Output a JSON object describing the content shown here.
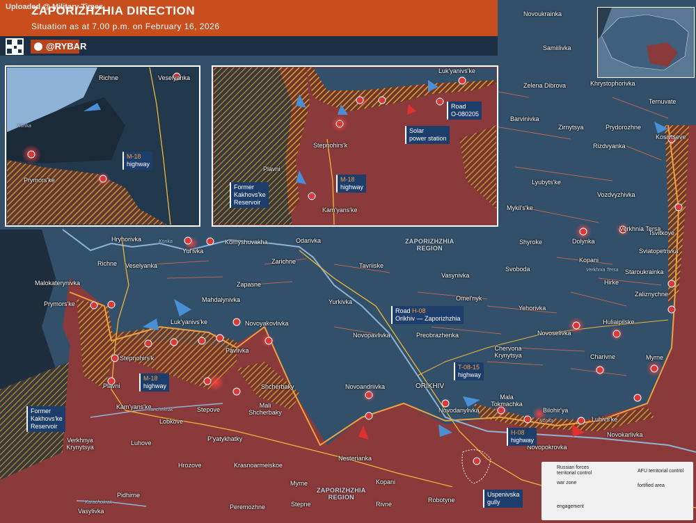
{
  "header": {
    "upload_text": "Uploaded @ Military Times",
    "title": "ZAPORIZHZHIA DIRECTION",
    "subtitle": "Situation as at 7.00 p.m. on February 16, 2026",
    "brand": "@RYBAR"
  },
  "colors": {
    "russian_control": "#8a3a3a",
    "afu_control": "#33506a",
    "war_zone": "#e89a3a",
    "front_line": "#f0a040",
    "header": "#c94e1e",
    "river": "#8fb3d6",
    "engagement": "#d83838"
  },
  "regions": [
    {
      "line1": "ZAPORIZHZHIA",
      "line2": "REGION"
    },
    {
      "line1": "ZAPORIZHZHIA",
      "line2": "REGION"
    }
  ],
  "settlements": {
    "main": [
      "Novoukrainka",
      "Samiilivka",
      "Zelena Dibrova",
      "Khrystophorivka",
      "Ternuvate",
      "Barvinivka",
      "Zirnytsya",
      "Prydorozhne",
      "Kosivtseve",
      "Rizdvyanka",
      "Lyubyts'ke",
      "Vozdvyzhivka",
      "Mykil's'ke",
      "Verkhnia Tersa",
      "Tsvitkove",
      "Shyroke",
      "Dolynka",
      "Sviatopetrivka",
      "Svoboda",
      "Kopani",
      "Staroukrainka",
      "Hirke",
      "Zaliznychne",
      "Vasynivka",
      "Omel'nyk",
      "Yehorivka",
      "Huliaipilske",
      "Novoselivka",
      "Charivne",
      "Myrne",
      "Chervona Krynytsya",
      "Preobrazhenka",
      "Novopavlivka",
      "Yurkivka",
      "Tavriiske",
      "Zarichne",
      "Odarivka",
      "Komyshuvakha",
      "Zapasne",
      "Mahdalynivka",
      "Novoyakovlivka",
      "Pavlivka",
      "Luk'yanivs'ke",
      "Yul'ivka",
      "Hryhorivka",
      "Richne",
      "Veselyanka",
      "Malokaterynivka",
      "Prymors'ke",
      "Stepnohirs'k",
      "Plavni",
      "Kam'yans'ke",
      "Stepove",
      "Mali Shcherbaky",
      "Shcherbaky",
      "Novoandriivka",
      "ORIKHIV",
      "Mala Tokmachka",
      "Novodanylivka",
      "Bilohir'ya",
      "Luhivs'ke",
      "Novokarlivka",
      "Novopokrovka",
      "Nesterianka",
      "Lobkove",
      "P'yatykhatky",
      "Luhove",
      "Verkhnya Krynytsya",
      "Hrozove",
      "Krasnoarmeiskoe",
      "Myrne",
      "Kopani",
      "Pidhirne",
      "Peremozhne",
      "Stepne",
      "Rivne",
      "Robotyne",
      "Vasylivka"
    ],
    "inset_left": [
      "Richne",
      "Veselyanka",
      "Prymors'ke"
    ],
    "inset_right": [
      "Luk'yanivs'ke",
      "Stepnohirs'k",
      "Plavni",
      "Kam'yans'ke"
    ]
  },
  "rivers": [
    "Konka",
    "Konka",
    "Konka",
    "Yanchekrak",
    "Karachokrak",
    "Verkhnia Tersa"
  ],
  "callouts": {
    "m18_main": {
      "name": "M-18",
      "type": "highway"
    },
    "m18_inset_left": {
      "name": "M-18",
      "type": "highway"
    },
    "m18_inset_right": {
      "name": "M-18",
      "type": "highway"
    },
    "road_o080205": {
      "line1": "Road",
      "line2": "O-080205"
    },
    "solar": {
      "line1": "Solar",
      "line2": "power station"
    },
    "reservoir_inset": {
      "line1": "Former",
      "line2": "Kakhovs'ke",
      "line3": "Reservoir"
    },
    "reservoir_main": {
      "line1": "Former",
      "line2": "Kakhovs'ke",
      "line3": "Reservoir"
    },
    "road_h08": {
      "line1": "Road",
      "code": "H-08",
      "line2": "Orikhiv — Zaporizhzhia"
    },
    "t0815": {
      "name": "T-08-15",
      "type": "highway"
    },
    "h08": {
      "name": "H-08",
      "type": "highway"
    },
    "uspenivska": {
      "line1": "Uspenivska",
      "line2": "gully"
    }
  },
  "legend": {
    "russian": "Russian forces territorial control",
    "afu": "AFU territorial control",
    "war_zone": "war zone",
    "fortified": "fortified area",
    "engagement": "engagement"
  }
}
